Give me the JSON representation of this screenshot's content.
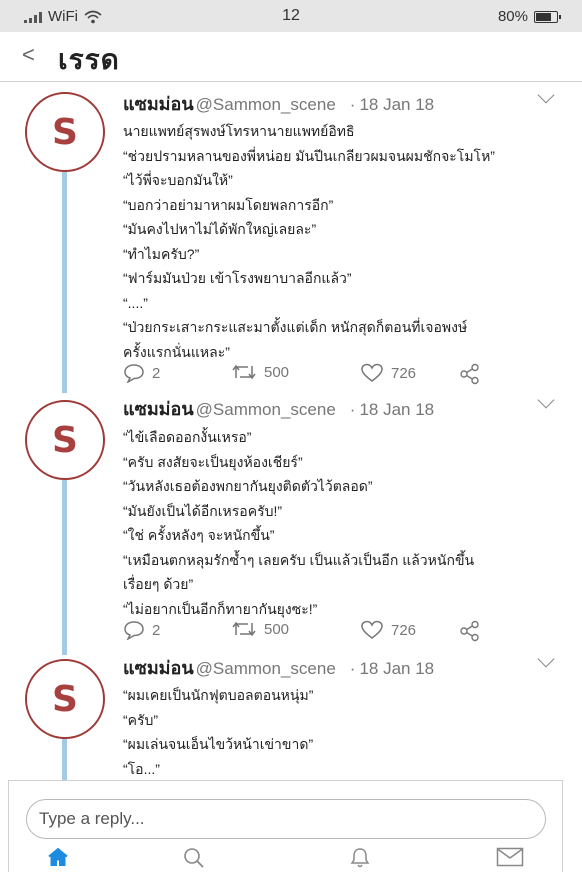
{
  "status": {
    "carrier": "WiFi",
    "time": "12",
    "battery": "80%",
    "battery_level": 0.8
  },
  "header": {
    "back_icon": "chevron-left-icon",
    "back_glyph": "<",
    "title": "เรรด"
  },
  "tweets": [
    {
      "avatar_letter": "S",
      "name": "แซมม่อน",
      "handle": "@Sammon_scene",
      "sep": "·",
      "date": "18 Jan 18",
      "lines": [
        "นายแพทย์สุรพงษ์โทรหานายแพทย์อิทธิ",
        "“ช่วยปรามหลานของพี่หน่อย มันปีนเกลียวผมจนผมชักจะโมโห”",
        "“ไว้พี่จะบอกมันให้”",
        "“บอกว่าอย่ามาหาผมโดยพลการอีก”",
        "“มันคงไปหาไม่ได้พักใหญ่เลยละ”",
        "“ทำไมครับ?”",
        "“ฟาร์มมันป่วย เข้าโรงพยาบาลอีกแล้ว”",
        "“....”",
        "“ป่วยกระเสาะกระแสะมาตั้งแต่เด็ก หนักสุดก็ตอนที่เจอพงษ์\nครั้งแรกนั่นแหละ”"
      ],
      "replies": "2",
      "retweets": "500",
      "likes": "726"
    },
    {
      "avatar_letter": "S",
      "name": "แซมม่อน",
      "handle": "@Sammon_scene",
      "sep": "·",
      "date": "18 Jan 18",
      "lines": [
        "“ไข้เลือดออกงั้นเหรอ”",
        "“ครับ สงสัยจะเป็นยุงห้องเชียร์”",
        "“วันหลังเธอต้องพกยากันยุงติดตัวไว้ตลอด”",
        "“มันยังเป็นได้อีกเหรอครับ!”",
        "“ใช่ ครั้งหลังๆ จะหนักขึ้น”",
        "“เหมือนตกหลุมรักซ้ำๆ เลยครับ เป็นแล้วเป็นอีก แล้วหนักขึ้น\nเรื่อยๆ ด้วย”",
        "“ไม่อยากเป็นอีกก็ทายากันยุงซะ!”"
      ],
      "replies": "2",
      "retweets": "500",
      "likes": "726"
    },
    {
      "avatar_letter": "S",
      "name": "แซมม่อน",
      "handle": "@Sammon_scene",
      "sep": "·",
      "date": "18 Jan 18",
      "lines": [
        "“ผมเคยเป็นนักฟุตบอลตอนหนุ่ม”",
        "“ครับ”",
        "“ผมเล่นจนเอ็นไขว้หน้าเข่าขาด”",
        "“โอ...”"
      ]
    }
  ],
  "reply": {
    "placeholder": "Type a reply..."
  },
  "tabs": [
    "home-icon",
    "search-icon",
    "bell-icon",
    "mail-icon"
  ],
  "colors": {
    "thread_line": "#a3cbe6",
    "avatar_border": "#9e3a38",
    "home_active": "#1d8ce0"
  }
}
